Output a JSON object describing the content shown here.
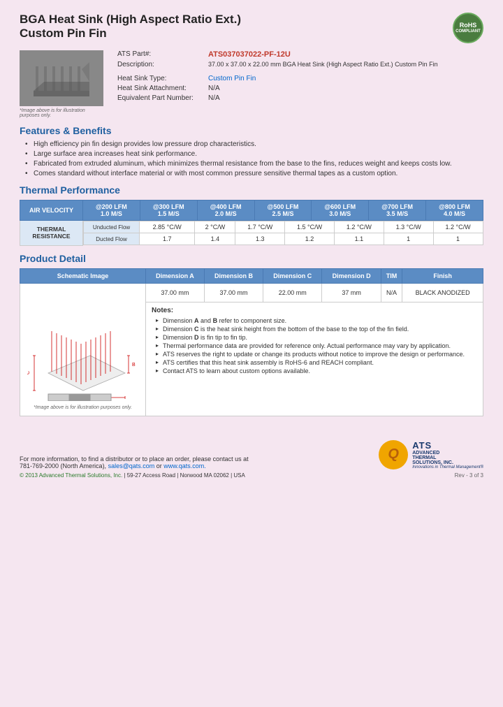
{
  "header": {
    "title_line1": "BGA Heat Sink (High Aspect Ratio Ext.)",
    "title_line2": "Custom Pin Fin",
    "rohs": {
      "line1": "RoHS",
      "line2": "COMPLIANT"
    }
  },
  "product": {
    "part_label": "ATS Part#:",
    "part_number": "ATS037037022-PF-12U",
    "desc_label": "Description:",
    "description": "37.00 x 37.00 x 22.00 mm  BGA Heat Sink (High Aspect Ratio Ext.) Custom Pin Fin",
    "type_label": "Heat Sink Type:",
    "type_value": "Custom Pin Fin",
    "attachment_label": "Heat Sink Attachment:",
    "attachment_value": "N/A",
    "equiv_label": "Equivalent Part Number:",
    "equiv_value": "N/A",
    "image_caption": "*Image above is for illustration purposes only."
  },
  "features": {
    "section_title": "Features & Benefits",
    "items": [
      "High efficiency pin fin design provides low pressure drop characteristics.",
      "Large surface area increases heat sink performance.",
      "Fabricated from extruded aluminum, which minimizes thermal resistance from the base to the fins, reduces weight and keeps costs low.",
      "Comes standard without interface material or with most common pressure sensitive thermal tapes as a custom option."
    ]
  },
  "thermal_performance": {
    "section_title": "Thermal Performance",
    "table": {
      "header_col1": "AIR VELOCITY",
      "columns": [
        {
          "label": "@200 LFM",
          "sub": "1.0 M/S"
        },
        {
          "label": "@300 LFM",
          "sub": "1.5 M/S"
        },
        {
          "label": "@400 LFM",
          "sub": "2.0 M/S"
        },
        {
          "label": "@500 LFM",
          "sub": "2.5 M/S"
        },
        {
          "label": "@600 LFM",
          "sub": "3.0 M/S"
        },
        {
          "label": "@700 LFM",
          "sub": "3.5 M/S"
        },
        {
          "label": "@800 LFM",
          "sub": "4.0 M/S"
        }
      ],
      "row_label": "THERMAL RESISTANCE",
      "rows": [
        {
          "label": "Unducted Flow",
          "values": [
            "2.85 °C/W",
            "2 °C/W",
            "1.7 °C/W",
            "1.5 °C/W",
            "1.2 °C/W",
            "1.3 °C/W",
            "1.2 °C/W"
          ]
        },
        {
          "label": "Ducted Flow",
          "values": [
            "1.7",
            "1.4",
            "1.3",
            "1.2",
            "1.1",
            "1",
            "1"
          ]
        }
      ]
    }
  },
  "product_detail": {
    "section_title": "Product Detail",
    "table_headers": [
      "Schematic Image",
      "Dimension A",
      "Dimension B",
      "Dimension C",
      "Dimension D",
      "TIM",
      "Finish"
    ],
    "dim_a": "37.00 mm",
    "dim_b": "37.00 mm",
    "dim_c": "22.00 mm",
    "dim_d": "37 mm",
    "tim": "N/A",
    "finish": "BLACK ANODIZED",
    "schematic_caption": "*Image above is for illustration purposes only.",
    "notes_title": "Notes:",
    "notes": [
      "Dimension A and B refer to component size.",
      "Dimension C is the heat sink height from the bottom of the base to the top of the fin field.",
      "Dimension D is fin tip to fin tip.",
      "Thermal performance data are provided for reference only. Actual performance may vary by application.",
      "ATS reserves the right to update or change its products without notice to improve the design or performance.",
      "ATS certifies that this heat sink assembly is RoHS-6 and REACH compliant.",
      "Contact ATS to learn about custom options available."
    ]
  },
  "footer": {
    "contact_text": "For more information, to find a distributor or to place an order, please contact us at",
    "phone": "781-769-2000 (North America),",
    "email": "sales@qats.com",
    "or": "or",
    "website": "www.qats.com.",
    "copyright": "© 2013 Advanced Thermal Solutions, Inc.",
    "address": "| 59-27 Access Road  |  Norwood MA  02062  | USA",
    "logo_q": "Q",
    "logo_ats": "ATS",
    "logo_full1": "ADVANCED",
    "logo_full2": "THERMAL",
    "logo_full3": "SOLUTIONS, INC.",
    "logo_tagline": "Innovations in Thermal Management®",
    "page_num": "Rev - 3 of 3"
  }
}
